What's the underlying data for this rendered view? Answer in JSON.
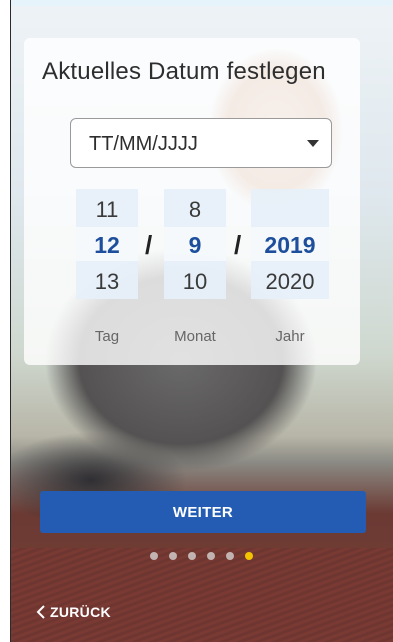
{
  "title": "Aktuelles Datum festlegen",
  "format_select": {
    "value": "TT/MM/JJJJ"
  },
  "pickers": {
    "day": {
      "prev": "11",
      "selected": "12",
      "next": "13",
      "label": "Tag"
    },
    "month": {
      "prev": "8",
      "selected": "9",
      "next": "10",
      "label": "Monat"
    },
    "year": {
      "prev": "",
      "selected": "2019",
      "next": "2020",
      "label": "Jahr"
    }
  },
  "separator": "/",
  "continue_button": "WEITER",
  "back_button": "ZURÜCK",
  "pagination": {
    "total": 6,
    "active_index": 5
  },
  "colors": {
    "accent": "#245cb4",
    "selected_value": "#1d4f9c",
    "active_dot": "#f4c300"
  },
  "icons": {
    "back": "chevron-left-icon",
    "format_dropdown": "caret-down-icon"
  }
}
